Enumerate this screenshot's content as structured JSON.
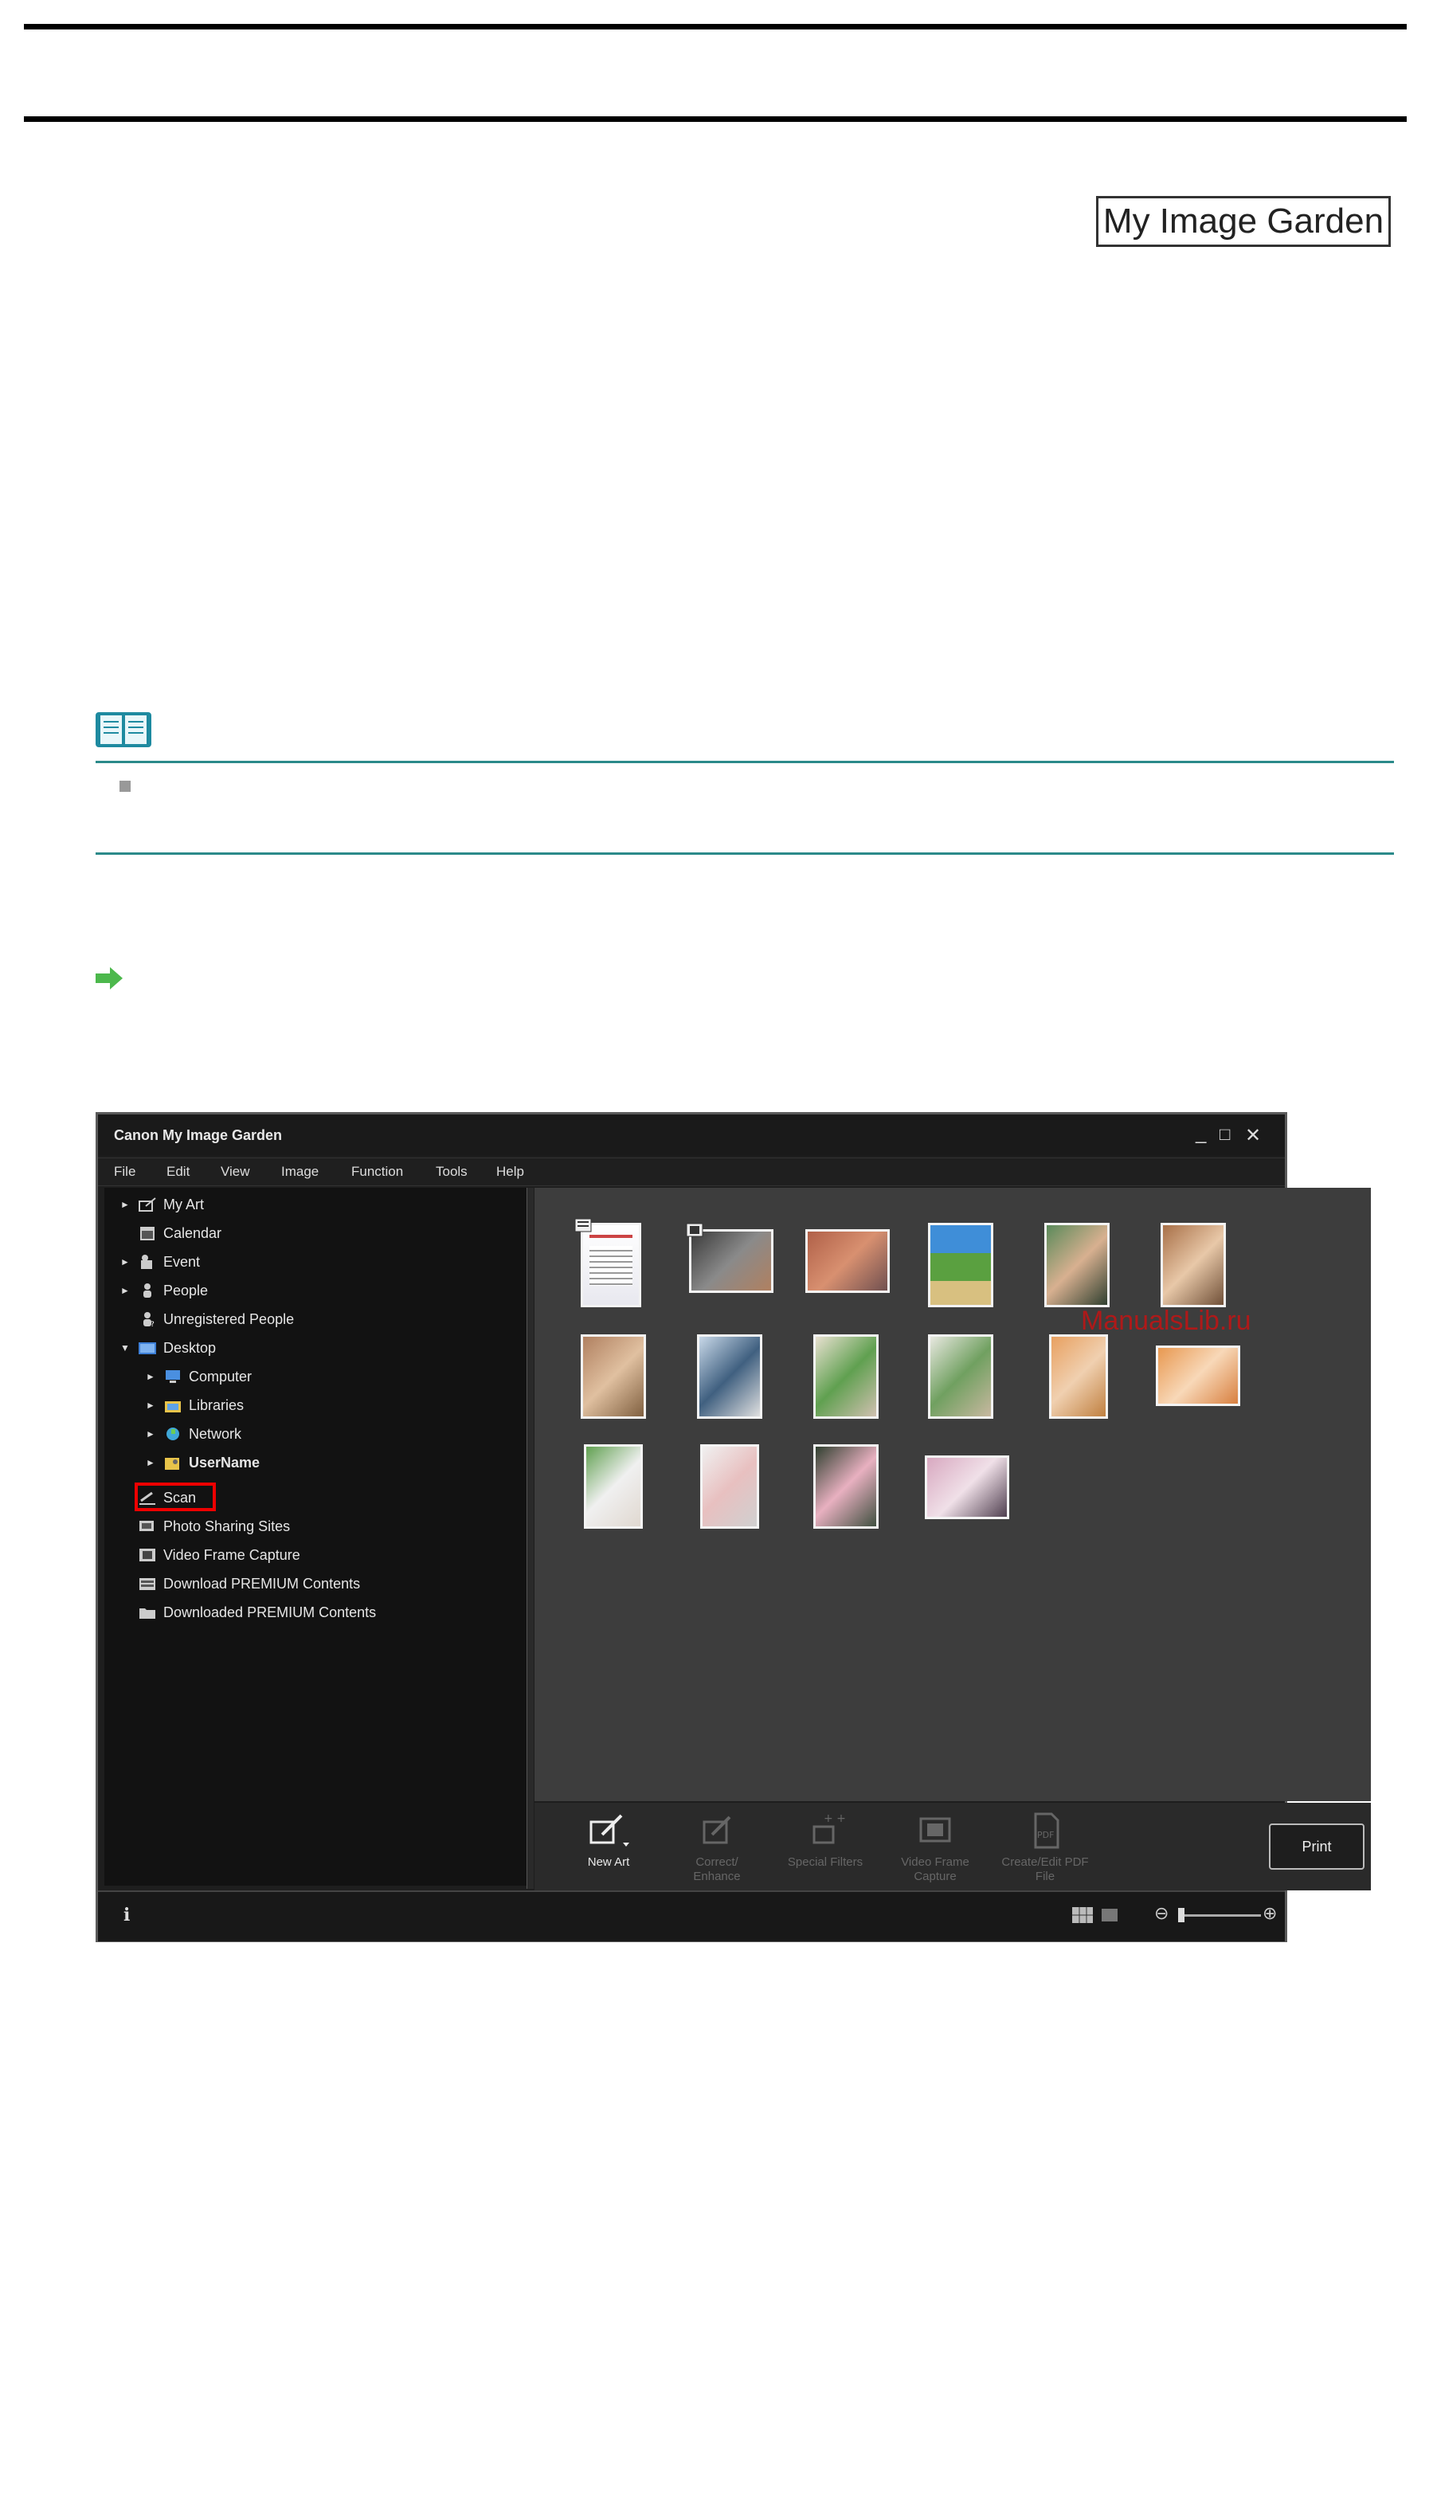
{
  "header_badge": "My Image Garden",
  "app": {
    "title": "Canon My Image Garden",
    "window_controls": [
      "_",
      "□",
      "✕"
    ],
    "menu": [
      "File",
      "Edit",
      "View",
      "Image",
      "Function",
      "Tools",
      "Help"
    ],
    "sidebar": [
      {
        "label": "My Art",
        "arrow": "►",
        "icon": "my-art-icon"
      },
      {
        "label": "Calendar",
        "arrow": "",
        "icon": "calendar-icon"
      },
      {
        "label": "Event",
        "arrow": "►",
        "icon": "event-icon"
      },
      {
        "label": "People",
        "arrow": "►",
        "icon": "people-icon"
      },
      {
        "label": "Unregistered People",
        "arrow": "",
        "icon": "unregistered-people-icon"
      },
      {
        "label": "Desktop",
        "arrow": "▼",
        "icon": "desktop-icon"
      },
      {
        "label": "Computer",
        "arrow": "►",
        "icon": "computer-icon"
      },
      {
        "label": "Libraries",
        "arrow": "►",
        "icon": "libraries-icon"
      },
      {
        "label": "Network",
        "arrow": "►",
        "icon": "network-icon"
      },
      {
        "label": "UserName",
        "arrow": "►",
        "icon": "user-folder-icon"
      },
      {
        "label": "Scan",
        "arrow": "",
        "icon": "scan-icon"
      },
      {
        "label": "Photo Sharing Sites",
        "arrow": "",
        "icon": "photo-sharing-icon"
      },
      {
        "label": "Video Frame Capture",
        "arrow": "",
        "icon": "video-frame-icon"
      },
      {
        "label": "Download PREMIUM Contents",
        "arrow": "",
        "icon": "download-icon"
      },
      {
        "label": "Downloaded PREMIUM Contents",
        "arrow": "",
        "icon": "folder-icon"
      }
    ],
    "toolbar": {
      "new_art": "New Art",
      "correct_enhance": "Correct/ Enhance",
      "special_filters": "Special Filters",
      "video_frame_capture": "Video Frame Capture",
      "create_edit_pdf": "Create/Edit PDF File",
      "print": "Print"
    },
    "status": {
      "info": "i",
      "zoom_minus": "⊖",
      "zoom_plus": "⊕"
    },
    "watermark": "ManualsLib.ru"
  },
  "colors": {
    "note_rule": "#2b8a8a",
    "highlight": "#ee0000",
    "arrow": "#4cb84c"
  }
}
